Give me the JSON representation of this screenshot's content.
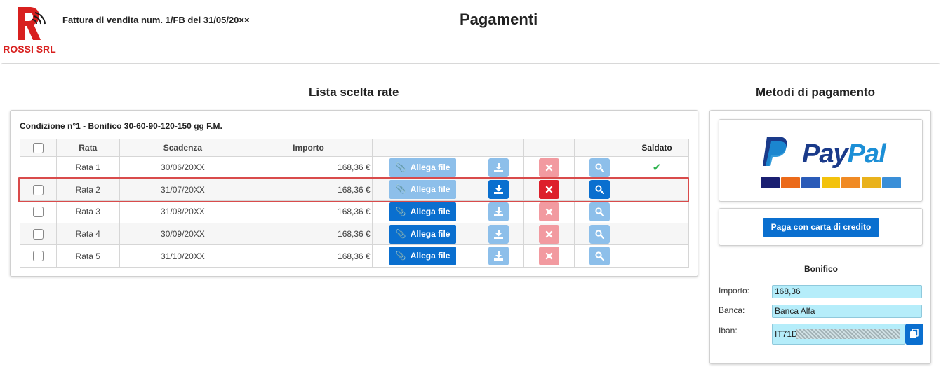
{
  "header": {
    "logo_text": "ROSSI SRL",
    "document_title": "Fattura di vendita num. 1/FB del 31/05/20××",
    "page_title": "Pagamenti"
  },
  "rates_section": {
    "title": "Lista scelta rate",
    "condition": "Condizione n°1 - Bonifico 30-60-90-120-150 gg F.M.",
    "columns": [
      "",
      "Rata",
      "Scadenza",
      "Importo",
      "",
      "",
      "",
      "",
      "Saldato"
    ],
    "attach_label": "Allega file",
    "rows": [
      {
        "rata": "Rata 1",
        "scadenza": "30/06/20XX",
        "importo": "168,36 €",
        "saldato": true,
        "checkbox": false
      },
      {
        "rata": "Rata 2",
        "scadenza": "31/07/20XX",
        "importo": "168,36 €",
        "saldato": false,
        "checkbox": true,
        "highlighted": true
      },
      {
        "rata": "Rata 3",
        "scadenza": "31/08/20XX",
        "importo": "168,36 €",
        "saldato": false,
        "checkbox": true
      },
      {
        "rata": "Rata 4",
        "scadenza": "30/09/20XX",
        "importo": "168,36 €",
        "saldato": false,
        "checkbox": true
      },
      {
        "rata": "Rata 5",
        "scadenza": "31/10/20XX",
        "importo": "168,36 €",
        "saldato": false,
        "checkbox": true
      }
    ]
  },
  "payment_section": {
    "title": "Metodi di pagamento",
    "paypal_word_1": "Pay",
    "paypal_word_2": "Pal",
    "card_button": "Paga con carta di credito",
    "bonifico_title": "Bonifico",
    "importo_label": "Importo:",
    "importo_value": "168,36",
    "banca_label": "Banca:",
    "banca_value": "Banca Alfa",
    "iban_label": "Iban:",
    "iban_value": "IT71D"
  },
  "colors": {
    "primary": "#0a6fcf",
    "danger": "#dd1f2b",
    "highlight_border": "#d94b4b",
    "success": "#2bb24c",
    "input_bg": "#b5edfa"
  }
}
